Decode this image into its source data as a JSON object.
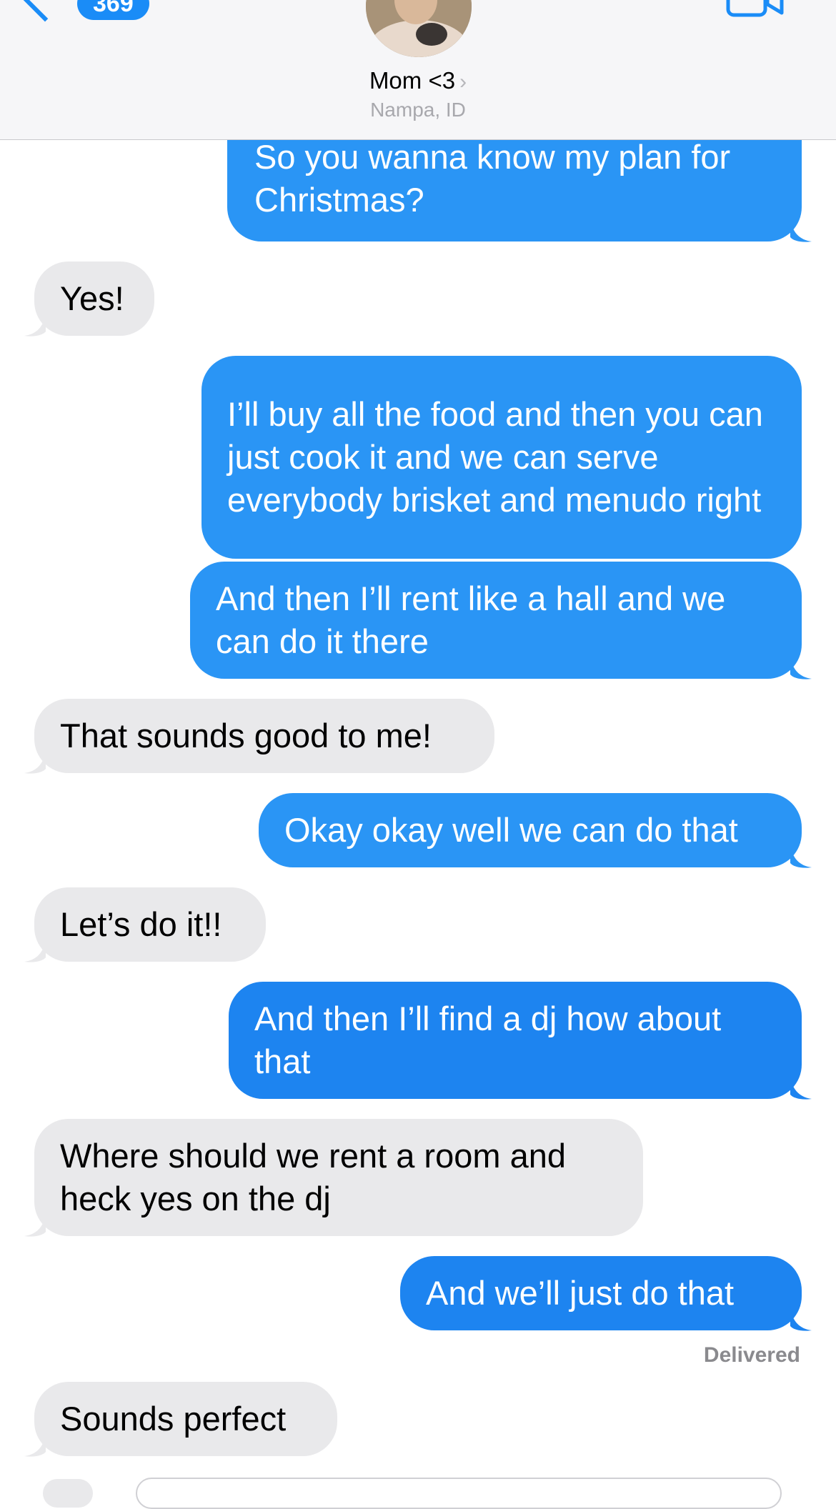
{
  "header": {
    "back_badge": "369",
    "contact_name": "Mom <3",
    "contact_chevron": "›",
    "contact_location": "Nampa, ID",
    "accent": "#1a8cf7"
  },
  "messages": [
    {
      "dir": "out",
      "text": "So you wanna know my plan for Christmas?"
    },
    {
      "dir": "in",
      "text": "Yes!"
    },
    {
      "dir": "out",
      "text": "I’ll buy all the food and then you can just cook it and we can serve everybody brisket and menudo right"
    },
    {
      "dir": "out",
      "text": "And then I’ll rent like a hall and we can do it there"
    },
    {
      "dir": "in",
      "text": "That sounds good to me!"
    },
    {
      "dir": "out",
      "text": "Okay okay well we can do that"
    },
    {
      "dir": "in",
      "text": "Let’s do it!!"
    },
    {
      "dir": "out",
      "text": "And then I’ll find a dj how about that"
    },
    {
      "dir": "in",
      "text": "Where should we rent a room and heck yes on the dj"
    },
    {
      "dir": "out",
      "text": "And we’ll just do that"
    },
    {
      "dir": "in",
      "text": "Sounds perfect"
    }
  ],
  "status": {
    "delivered": "Delivered"
  },
  "colors": {
    "outgoing_bubble": "#2a95f5",
    "incoming_bubble": "#e9e9eb"
  },
  "icons": {
    "back": "chevron-left-icon",
    "video": "video-camera-icon"
  }
}
